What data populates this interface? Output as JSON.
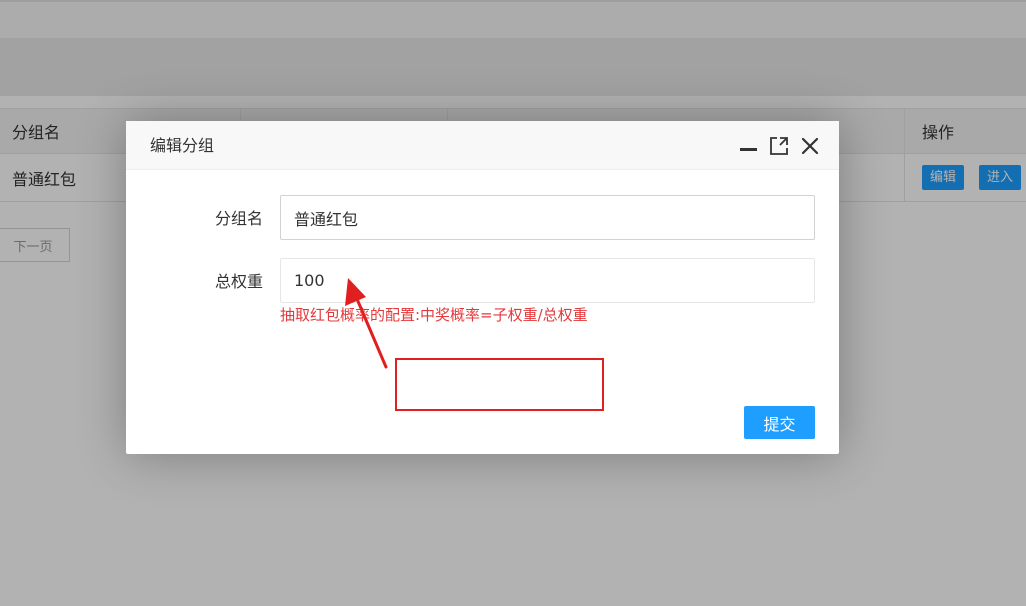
{
  "background": {
    "table": {
      "headers": [
        "分组名",
        "操作"
      ],
      "row": {
        "name": "普通红包",
        "edit_label": "编辑",
        "enter_label": "进入"
      }
    },
    "pager": {
      "next_label": "下一页"
    }
  },
  "dialog": {
    "title": "编辑分组",
    "fields": {
      "group_name": {
        "label": "分组名",
        "value": "普通红包"
      },
      "total_weight": {
        "label": "总权重",
        "value": "100"
      }
    },
    "hint": "抽取红包概率的配置:中奖概率=子权重/总权重",
    "submit_label": "提交"
  },
  "colors": {
    "accent": "#1E9FFF",
    "hint": "#e4393c",
    "annotation": "#e02020"
  },
  "icons": [
    "minimize-icon",
    "maximize-icon",
    "close-icon"
  ]
}
